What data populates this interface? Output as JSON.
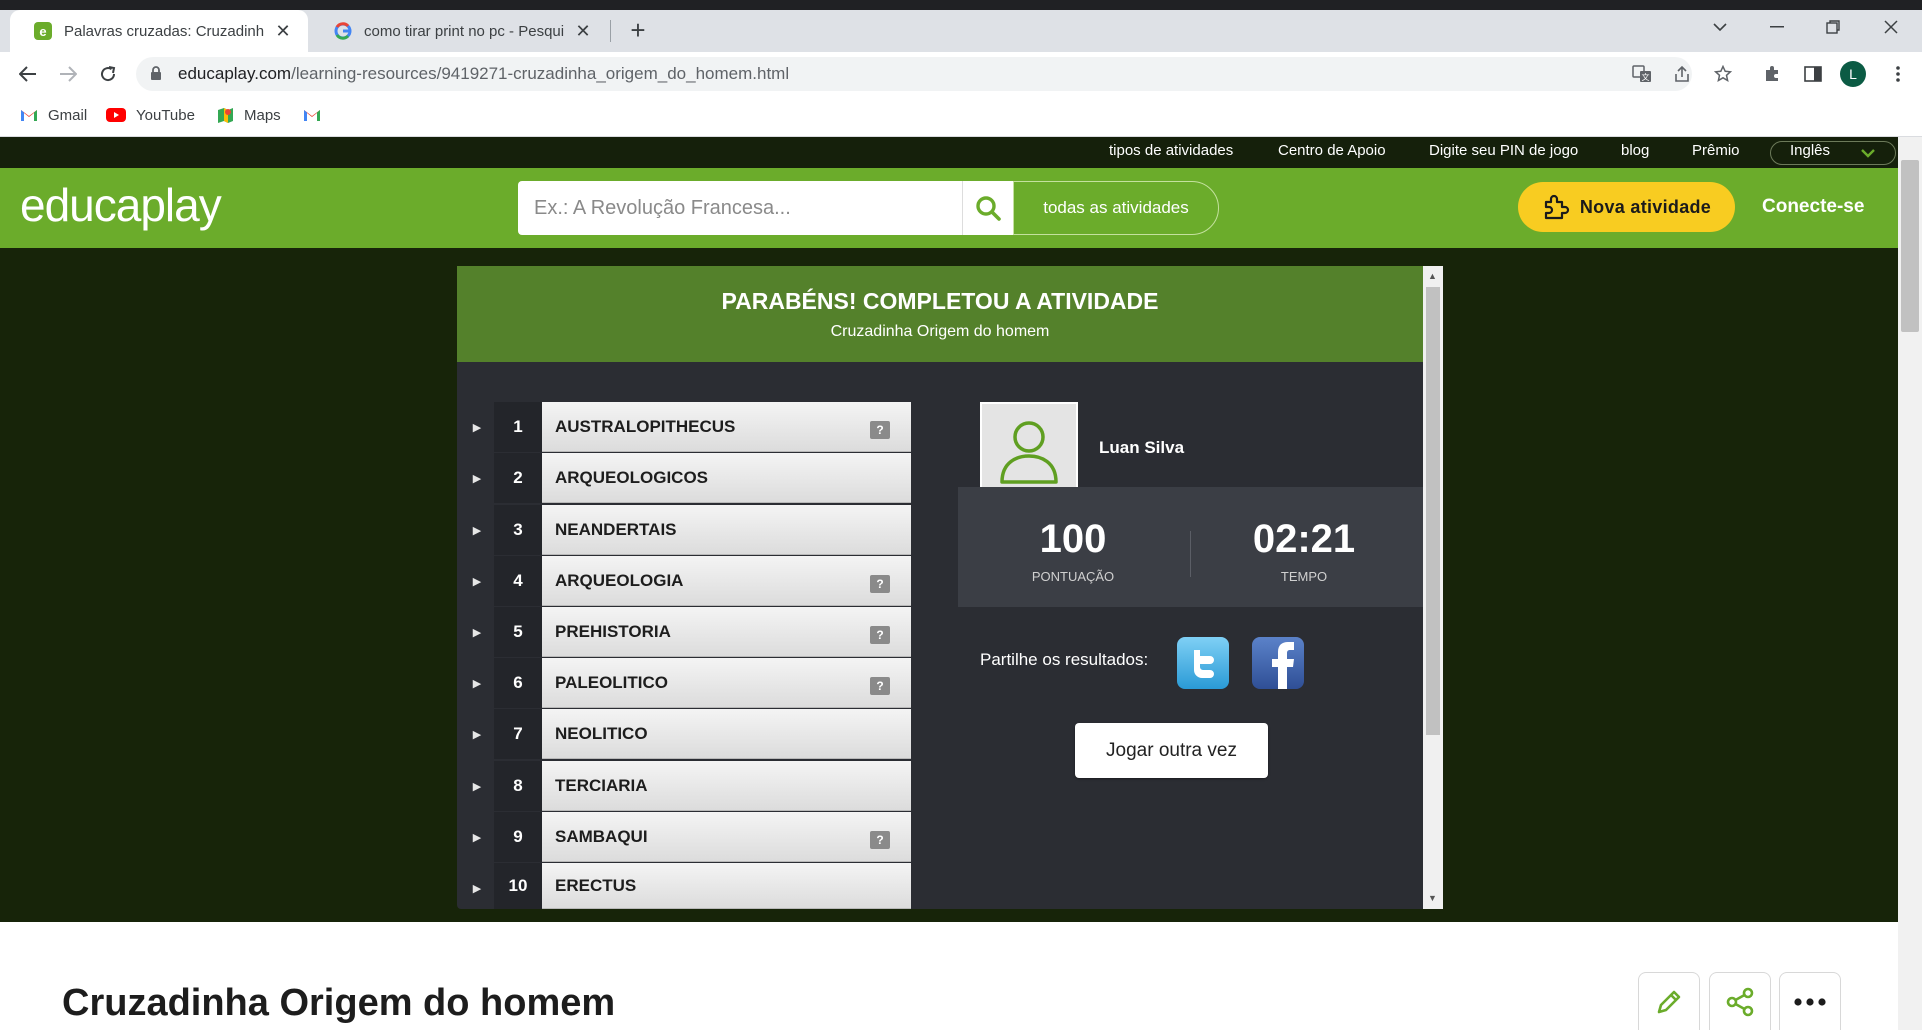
{
  "browser": {
    "tabs": [
      {
        "title": "Palavras cruzadas: Cruzadinha Origem do homem",
        "active": true,
        "favicon": "educaplay-favicon"
      },
      {
        "title": "como tirar print no pc - Pesquisa Google",
        "active": false,
        "favicon": "google-favicon"
      }
    ],
    "url_host": "educaplay.com",
    "url_path": "/learning-resources/9419271-cruzadinha_origem_do_homem.html",
    "profile_initial": "L",
    "bookmarks": [
      {
        "label": "Gmail",
        "icon": "gmail-icon"
      },
      {
        "label": "YouTube",
        "icon": "youtube-icon"
      },
      {
        "label": "Maps",
        "icon": "maps-icon"
      },
      {
        "label": "",
        "icon": "gmail-icon"
      }
    ]
  },
  "site": {
    "topnav": [
      "tipos de atividades",
      "Centro de Apoio",
      "Digite seu PIN de jogo",
      "blog",
      "Prêmio"
    ],
    "language": "Inglês",
    "logo": "educaplay",
    "search_placeholder": "Ex.: A Revolução Francesa...",
    "filter_label": "todas as atividades",
    "new_activity_label": "Nova atividade",
    "login_label": "Conecte-se",
    "brand_green": "#6bac2b",
    "accent_yellow": "#f8cc21"
  },
  "result": {
    "title": "PARABÉNS! COMPLETOU A ATIVIDADE",
    "subtitle": "Cruzadinha Origem do homem",
    "answers": [
      {
        "num": "1",
        "word": "AUSTRALOPITHECUS",
        "hint": true
      },
      {
        "num": "2",
        "word": "ARQUEOLOGICOS",
        "hint": false
      },
      {
        "num": "3",
        "word": "NEANDERTAIS",
        "hint": false
      },
      {
        "num": "4",
        "word": "ARQUEOLOGIA",
        "hint": true
      },
      {
        "num": "5",
        "word": "PREHISTORIA",
        "hint": true
      },
      {
        "num": "6",
        "word": "PALEOLITICO",
        "hint": true
      },
      {
        "num": "7",
        "word": "NEOLITICO",
        "hint": false
      },
      {
        "num": "8",
        "word": "TERCIARIA",
        "hint": false
      },
      {
        "num": "9",
        "word": "SAMBAQUI",
        "hint": true
      },
      {
        "num": "10",
        "word": "ERECTUS",
        "hint": false
      }
    ],
    "hint_glyph": "?",
    "user_name": "Luan Silva",
    "score": "100",
    "score_label": "PONTUAÇÃO",
    "time": "02:21",
    "time_label": "TEMPO",
    "share_label": "Partilhe os resultados:",
    "replay_label": "Jogar outra vez"
  },
  "page": {
    "heading": "Cruzadinha Origem do homem"
  }
}
